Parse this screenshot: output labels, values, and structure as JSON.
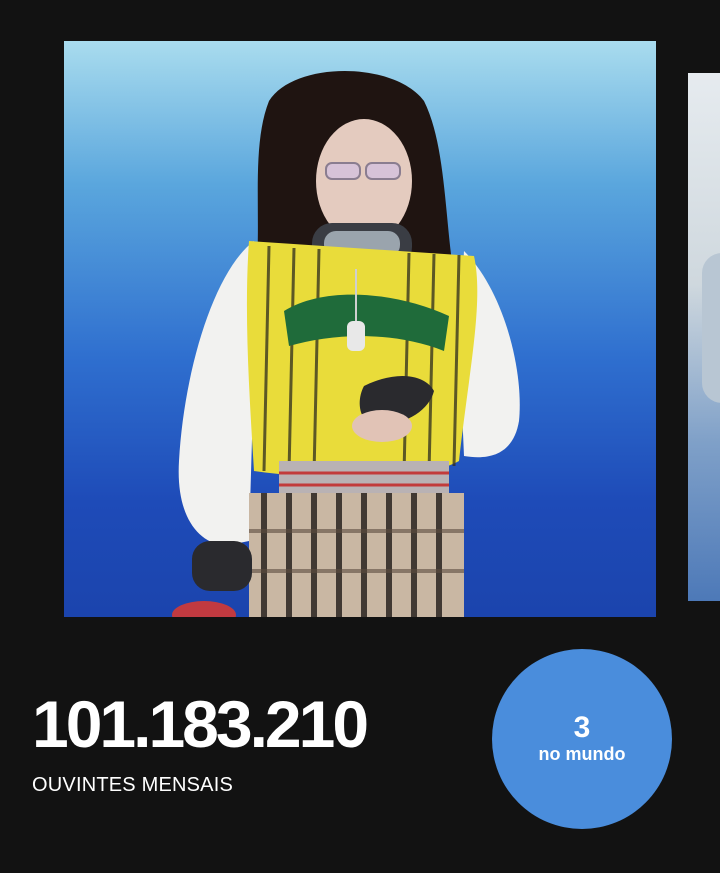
{
  "artist": {
    "monthly_listeners": "101.183.210",
    "monthly_listeners_label": "OUVINTES MENSAIS"
  },
  "rank": {
    "position": "3",
    "scope_label": "no mundo"
  },
  "colors": {
    "background": "#121212",
    "badge": "#4a8ddc",
    "photo_top": "#a9dcee",
    "photo_bottom": "#1b44ad"
  },
  "gallery": {
    "items": [
      "artist-photo",
      "next-photo"
    ]
  }
}
